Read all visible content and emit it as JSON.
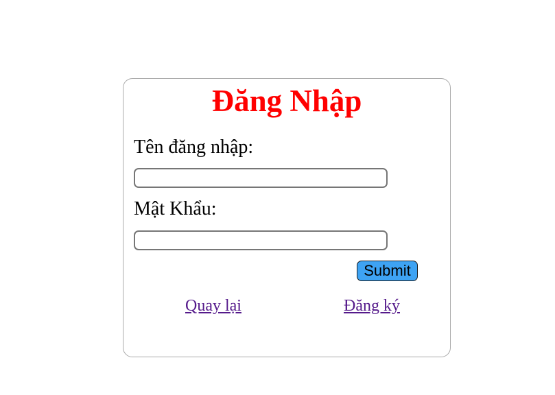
{
  "login": {
    "title": "Đăng Nhập",
    "username_label": "Tên đăng nhập:",
    "username_value": "",
    "password_label": "Mật Khẩu:",
    "password_value": "",
    "submit_label": "Submit",
    "back_link": "Quay lại",
    "register_link": "Đăng ký"
  },
  "colors": {
    "title": "#ff0000",
    "submit_bg": "#3ea3f3",
    "link": "#551a8b",
    "card_border": "#a9a9a9"
  }
}
